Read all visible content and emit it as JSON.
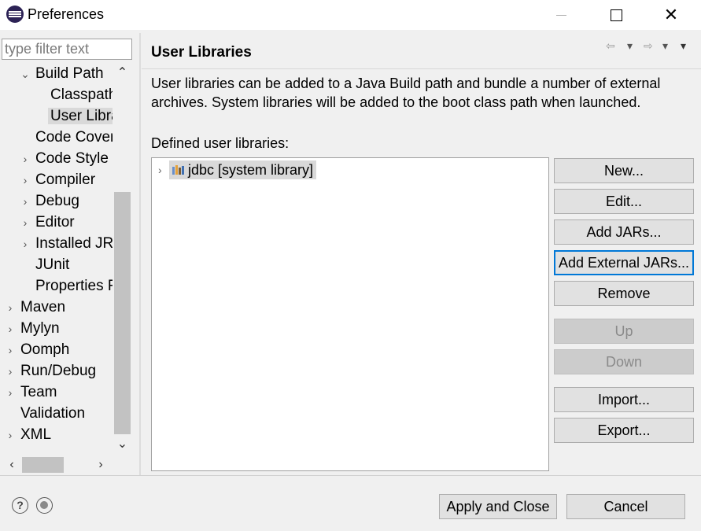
{
  "window": {
    "title": "Preferences",
    "minimize_glyph": "—",
    "maximize_glyph": "☐",
    "close_glyph": "✕"
  },
  "filter": {
    "placeholder": "type filter text",
    "value": ""
  },
  "tree": {
    "items": [
      {
        "label": "Build Path",
        "arrow": "⌄",
        "level": 1,
        "expanded": true
      },
      {
        "label": "Classpath",
        "arrow": "",
        "level": 2
      },
      {
        "label": "User Libra",
        "arrow": "",
        "level": 2,
        "selected": true
      },
      {
        "label": "Code Cover",
        "arrow": "",
        "level": 1
      },
      {
        "label": "Code Style",
        "arrow": "›",
        "level": 1
      },
      {
        "label": "Compiler",
        "arrow": "›",
        "level": 1
      },
      {
        "label": "Debug",
        "arrow": "›",
        "level": 1
      },
      {
        "label": "Editor",
        "arrow": "›",
        "level": 1
      },
      {
        "label": "Installed JR",
        "arrow": "›",
        "level": 1
      },
      {
        "label": "JUnit",
        "arrow": "",
        "level": 1
      },
      {
        "label": "Properties F",
        "arrow": "",
        "level": 1
      },
      {
        "label": "Maven",
        "arrow": "›",
        "level": 0
      },
      {
        "label": "Mylyn",
        "arrow": "›",
        "level": 0
      },
      {
        "label": "Oomph",
        "arrow": "›",
        "level": 0
      },
      {
        "label": "Run/Debug",
        "arrow": "›",
        "level": 0
      },
      {
        "label": "Team",
        "arrow": "›",
        "level": 0
      },
      {
        "label": "Validation",
        "arrow": "",
        "level": 0
      },
      {
        "label": "XML",
        "arrow": "›",
        "level": 0
      }
    ]
  },
  "scroll": {
    "up": "⌃",
    "down": "⌄",
    "left": "‹",
    "right": "›"
  },
  "page": {
    "title": "User Libraries",
    "nav": {
      "back": "⇦",
      "back_menu": "▾",
      "forward": "⇨",
      "forward_menu": "▾",
      "view_menu": "▾"
    },
    "description": "User libraries can be added to a Java Build path and bundle a number of external archives. System libraries will be added to the boot class path when launched.",
    "defined_label": "Defined user libraries:",
    "libraries": [
      {
        "arrow": "›",
        "label": "jdbc [system library]"
      }
    ],
    "buttons": {
      "new": "New...",
      "edit": "Edit...",
      "add_jars": "Add JARs...",
      "add_external_jars": "Add External JARs...",
      "remove": "Remove",
      "up": "Up",
      "down": "Down",
      "import": "Import...",
      "export": "Export..."
    }
  },
  "footer": {
    "help_glyph": "?",
    "apply_close": "Apply and Close",
    "cancel": "Cancel"
  }
}
